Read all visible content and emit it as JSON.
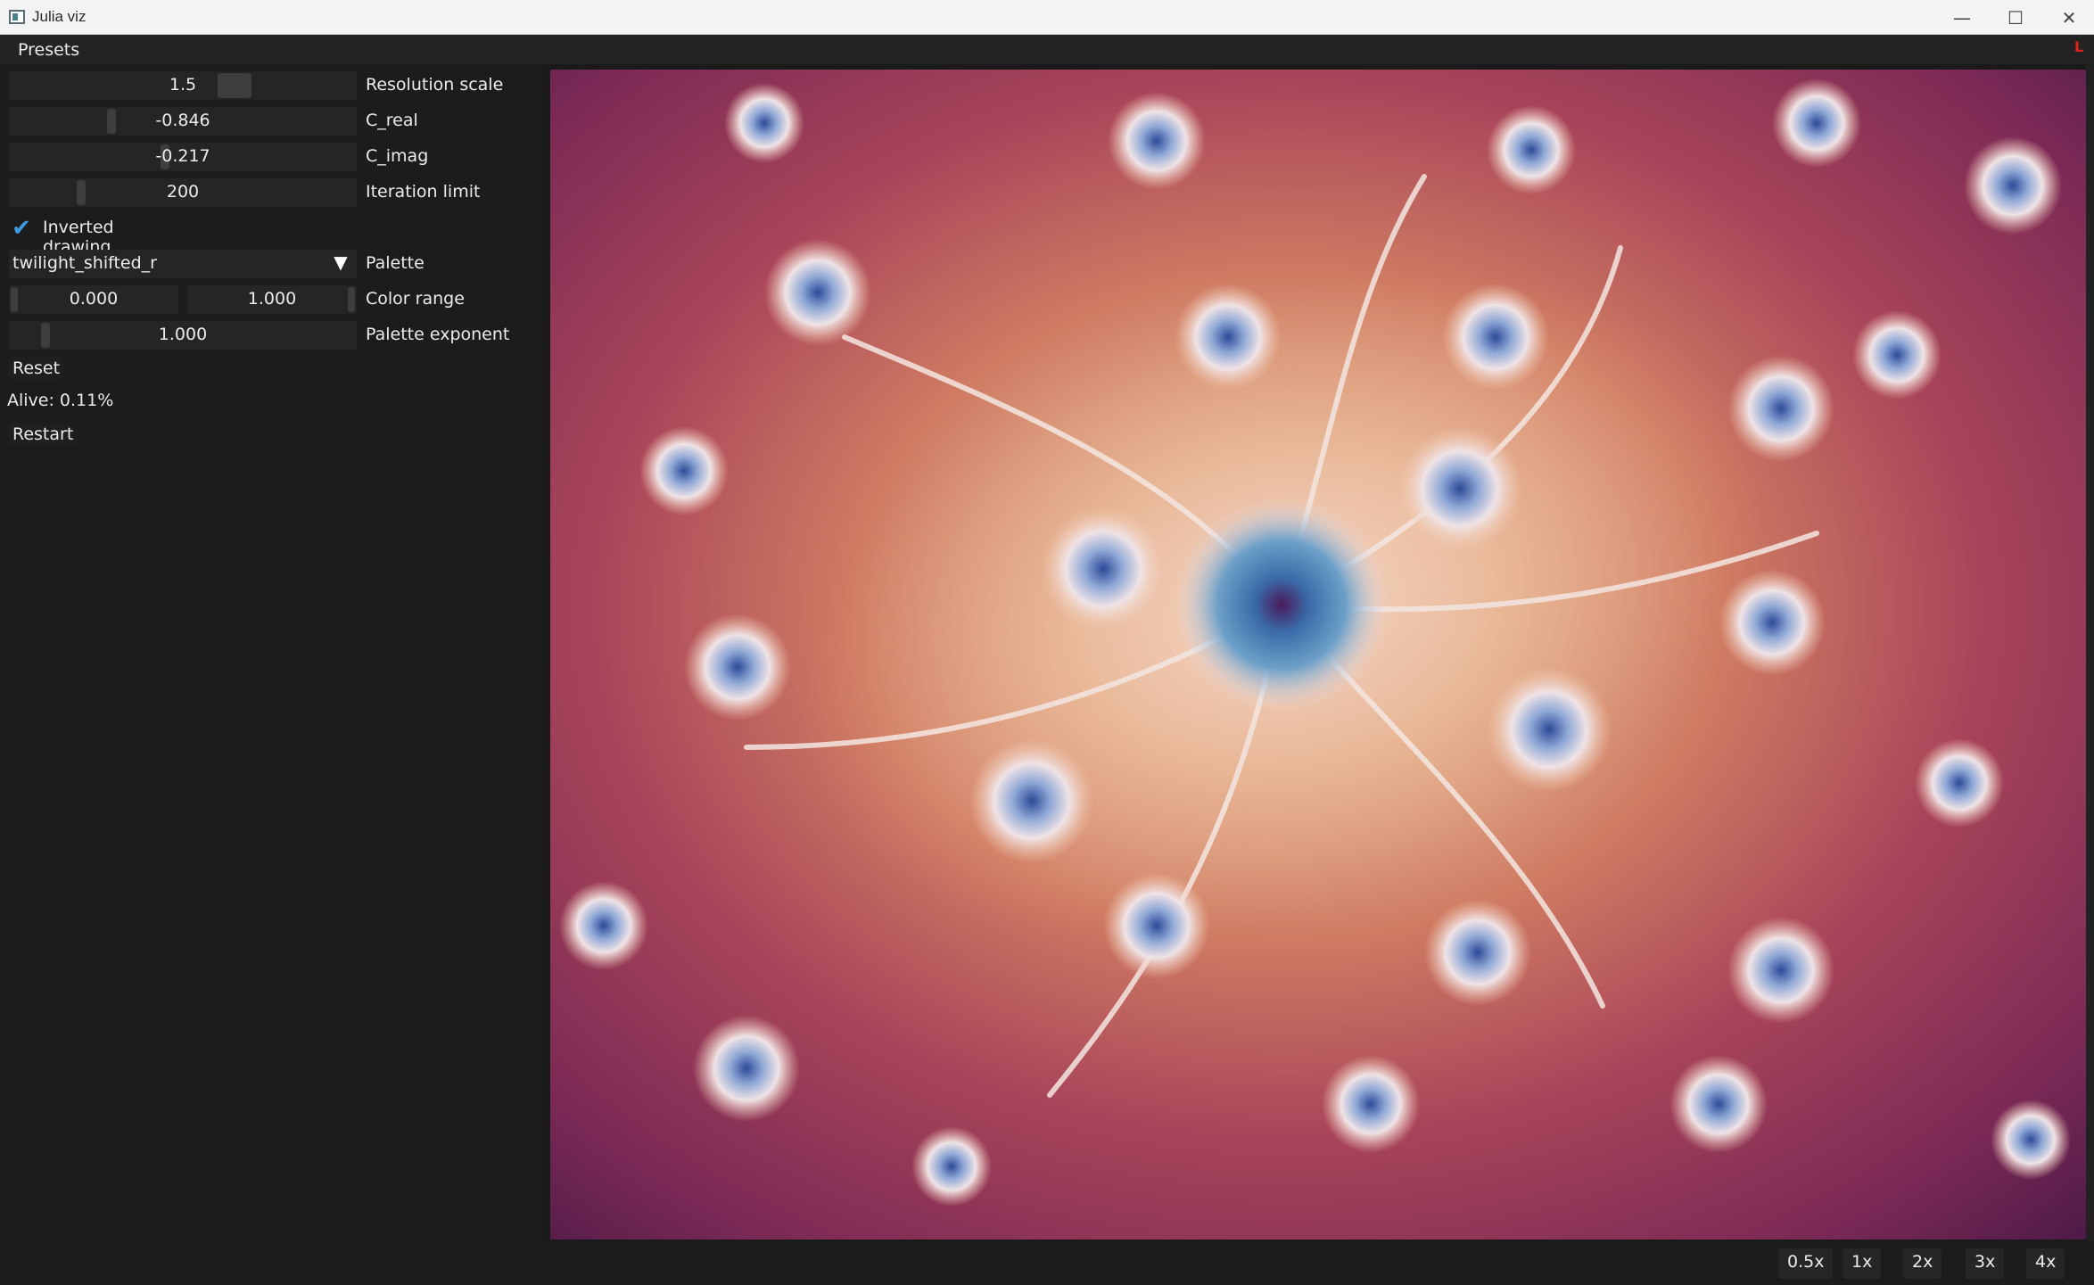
{
  "window": {
    "title": "Julia viz",
    "controls": {
      "minimize": "—",
      "maximize": "☐",
      "close": "✕"
    }
  },
  "menu": {
    "presets_label": "Presets",
    "indicator": "L"
  },
  "controls": {
    "resolution_scale": {
      "value": "1.5",
      "label": "Resolution scale",
      "level": 0.5
    },
    "c_real": {
      "value": "-0.846",
      "label": "C_real",
      "level": 0.3
    },
    "c_imag": {
      "value": "-0.217",
      "label": "C_imag",
      "level": 0.45
    },
    "iteration_limit": {
      "value": "200",
      "label": "Iteration limit",
      "level": 0.2
    },
    "inverted_drawing": {
      "checked": true,
      "label": "Inverted drawing",
      "check_glyph": "✔"
    },
    "palette": {
      "value": "twilight_shifted_r",
      "label": "Palette",
      "arrow": "▼"
    },
    "color_range": {
      "min": "0.000",
      "max": "1.000",
      "label": "Color range"
    },
    "palette_exponent": {
      "value": "1.000",
      "label": "Palette exponent",
      "level": 0.08
    },
    "reset_label": "Reset",
    "alive_status": "Alive: 0.11%",
    "restart_label": "Restart"
  },
  "zoom": {
    "buttons": [
      "0.5x",
      "1x",
      "2x",
      "3x",
      "4x"
    ]
  },
  "colors": {
    "fractal_dark": "#4a1842",
    "fractal_mid": "#a6445a",
    "fractal_warm": "#d98a6a",
    "fractal_light": "#e9d8dc",
    "fractal_core": "#3b5ba0",
    "accent_check": "#3f9be0"
  }
}
